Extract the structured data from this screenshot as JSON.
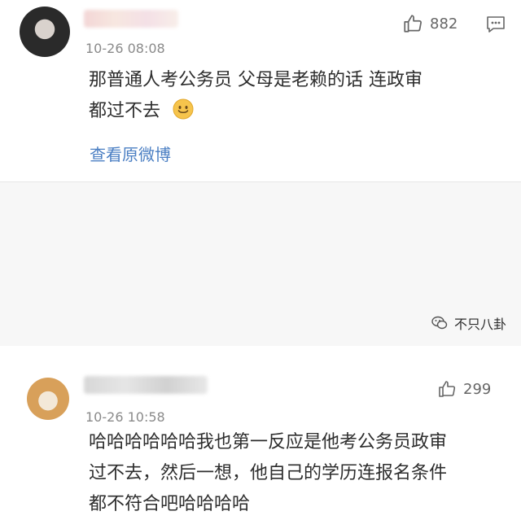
{
  "comments": [
    {
      "timestamp": "10-26 08:08",
      "likes": "882",
      "text_lines": [
        "那普通人考公务员 父母是老赖的话 连政审",
        "都过不去"
      ],
      "link": "查看原微博"
    },
    {
      "timestamp": "10-26 10:58",
      "likes": "299",
      "text_lines": [
        "哈哈哈哈哈哈我也第一反应是他考公务员政审",
        "过不去，然后一想，他自己的学历连报名条件",
        "都不符合吧哈哈哈哈"
      ]
    }
  ],
  "watermark": "不只八卦",
  "icons": {
    "like": "thumbs-up-icon",
    "reply": "comment-icon",
    "emoji": "smile-emoji-icon",
    "watermark": "wechat-logo-icon"
  }
}
